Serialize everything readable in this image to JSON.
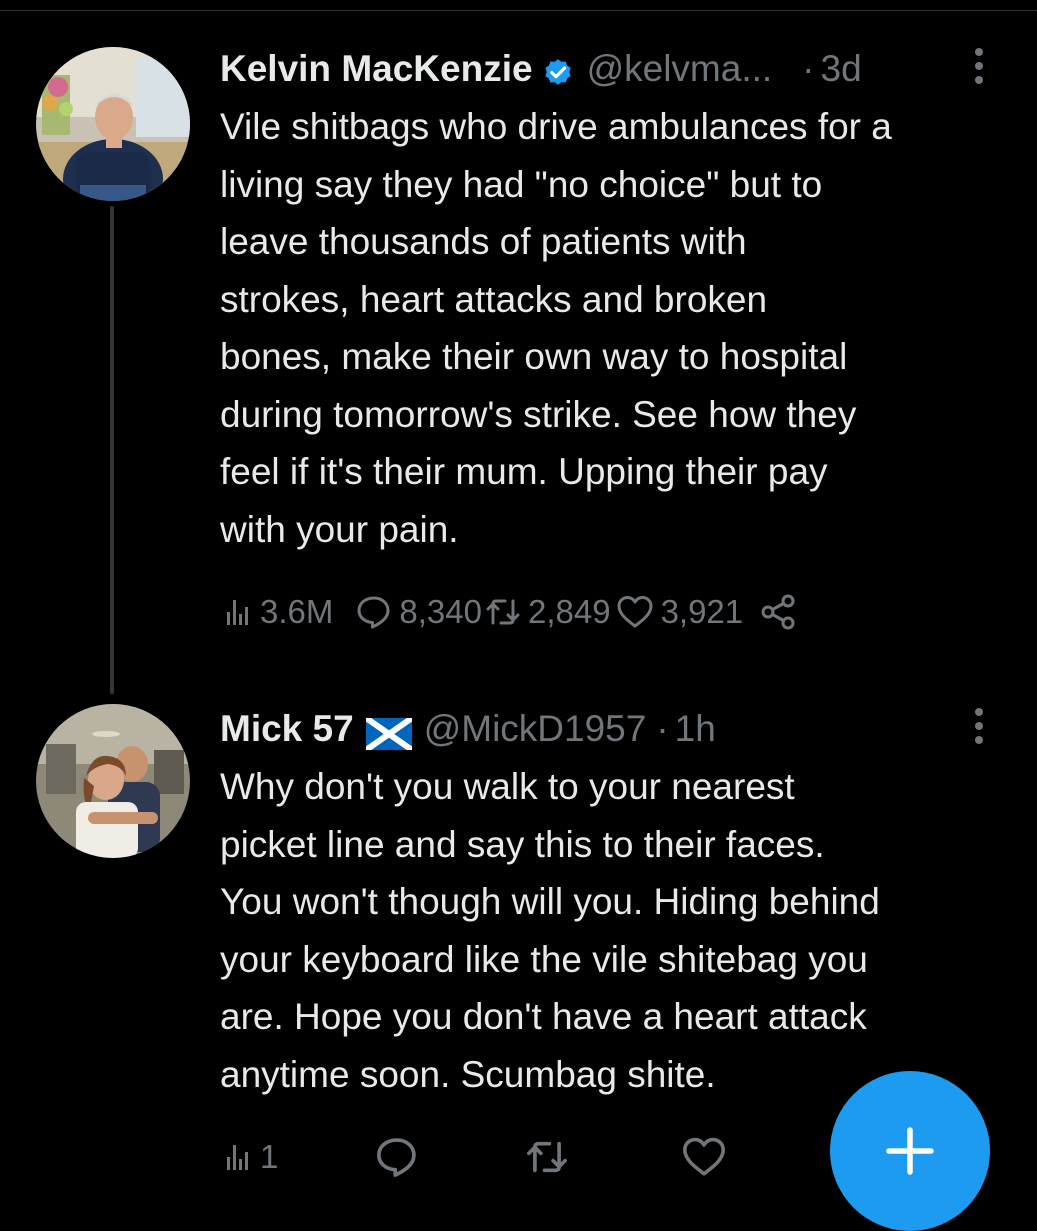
{
  "tweets": [
    {
      "author": {
        "display_name": "Kelvin MacKenzie",
        "verified": true,
        "handle": "@kelvma...",
        "avatar": "man-in-navy-polo-avatar"
      },
      "separator": "·",
      "timestamp": "3d",
      "body": "Vile shitbags who drive ambulances for a\nliving say they had \"no choice\" but to\nleave thousands of patients with\nstrokes, heart attacks and broken\nbones, make their own way to hospital\nduring tomorrow's strike. See how they\nfeel if it's their mum. Upping their pay\nwith your pain.",
      "stats": {
        "views": "3.6M",
        "replies": "8,340",
        "retweets": "2,849",
        "likes": "3,921"
      }
    },
    {
      "author": {
        "display_name": "Mick 57",
        "flag": "scotland-flag",
        "handle": "@MickD1957",
        "avatar": "couple-hugging-avatar"
      },
      "separator": "·",
      "timestamp": "1h",
      "body": "Why don't you walk to your nearest\npicket line and say this to their faces.\nYou won't though will you. Hiding behind\nyour keyboard like the vile shitebag you\nare. Hope you don't have a heart attack\nanytime soon. Scumbag shite.",
      "stats": {
        "views": "1"
      }
    }
  ],
  "icons": {
    "views": "bar-chart-icon",
    "reply": "speech-bubble-icon",
    "retweet": "retweet-arrows-icon",
    "like": "heart-icon",
    "share": "share-icon",
    "more": "vertical-ellipsis-icon",
    "compose": "plus-icon"
  },
  "colors": {
    "background": "#000000",
    "text_primary": "#e7e9ea",
    "text_secondary": "#71767b",
    "accent": "#1d9bf0",
    "thread_line": "#333639",
    "scotland_blue": "#0065bd"
  }
}
